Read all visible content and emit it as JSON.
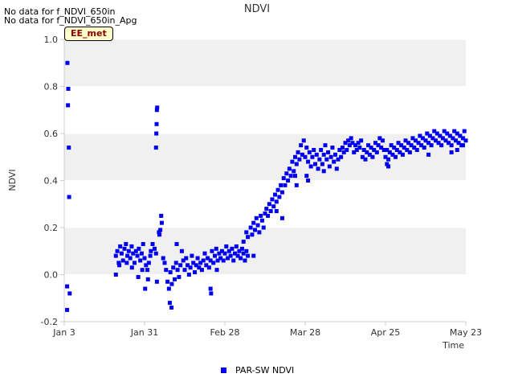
{
  "notes": [
    "No data for f_NDVI_650in",
    "No data for f_NDVI_650in_Apg"
  ],
  "badge": "EE_met",
  "colors": {
    "series": "#0000ee",
    "band": "#f0f0f0",
    "grid": "#ffffff",
    "axis": "#cccccc",
    "text": "#333333"
  },
  "chart_data": {
    "type": "scatter",
    "title": "NDVI",
    "xlabel": "Time",
    "ylabel": "NDVI",
    "ylim": [
      -0.2,
      1.0
    ],
    "yticks": [
      "-0.2",
      "0.0",
      "0.2",
      "0.4",
      "0.6",
      "0.8",
      "1.0"
    ],
    "xlim": [
      "Jan 3",
      "May 23"
    ],
    "xticks": [
      {
        "label": "Jan 3",
        "day": 0
      },
      {
        "label": "Jan 31",
        "day": 28
      },
      {
        "label": "Feb 28",
        "day": 56
      },
      {
        "label": "Mar 28",
        "day": 84
      },
      {
        "label": "Apr 25",
        "day": 112
      },
      {
        "label": "May 23",
        "day": 140
      }
    ],
    "grid": true,
    "legend": "bottom-center",
    "series": [
      {
        "name": "PAR-SW NDVI",
        "points": [
          [
            1.0,
            -0.05
          ],
          [
            1.1,
            0.9
          ],
          [
            1.3,
            0.72
          ],
          [
            1.4,
            0.79
          ],
          [
            1.6,
            0.54
          ],
          [
            1.7,
            0.33
          ],
          [
            1.9,
            -0.08
          ],
          [
            1.0,
            -0.15
          ],
          [
            18.0,
            0.08
          ],
          [
            18.5,
            0.1
          ],
          [
            19.0,
            0.05
          ],
          [
            19.5,
            0.12
          ],
          [
            20.0,
            0.09
          ],
          [
            20.5,
            0.06
          ],
          [
            21.0,
            0.11
          ],
          [
            21.5,
            0.13
          ],
          [
            22.0,
            0.08
          ],
          [
            22.5,
            0.1
          ],
          [
            23.0,
            0.07
          ],
          [
            23.5,
            0.12
          ],
          [
            24.0,
            0.09
          ],
          [
            24.5,
            0.05
          ],
          [
            25.0,
            0.1
          ],
          [
            25.5,
            0.08
          ],
          [
            26.0,
            0.11
          ],
          [
            26.5,
            0.06
          ],
          [
            27.0,
            0.09
          ],
          [
            27.5,
            0.13
          ],
          [
            28.0,
            0.07
          ],
          [
            28.5,
            0.04
          ],
          [
            29.0,
            0.02
          ],
          [
            29.5,
            0.05
          ],
          [
            30.0,
            0.08
          ],
          [
            18.0,
            0.0
          ],
          [
            19.2,
            0.04
          ],
          [
            21.8,
            0.05
          ],
          [
            23.6,
            0.03
          ],
          [
            25.8,
            -0.01
          ],
          [
            27.2,
            0.02
          ],
          [
            28.2,
            -0.06
          ],
          [
            30.2,
            0.1
          ],
          [
            30.8,
            0.13
          ],
          [
            31.5,
            0.11
          ],
          [
            32.0,
            0.09
          ],
          [
            29.2,
            -0.02
          ],
          [
            32.3,
            -0.03
          ],
          [
            33.2,
            0.17
          ],
          [
            33.5,
            0.19
          ],
          [
            33.8,
            0.25
          ],
          [
            34.0,
            0.22
          ],
          [
            32.0,
            0.54
          ],
          [
            32.1,
            0.6
          ],
          [
            32.2,
            0.64
          ],
          [
            32.3,
            0.7
          ],
          [
            32.4,
            0.71
          ],
          [
            33.0,
            0.18
          ],
          [
            34.5,
            0.07
          ],
          [
            35.0,
            0.05
          ],
          [
            35.5,
            0.02
          ],
          [
            36.0,
            -0.03
          ],
          [
            36.5,
            -0.06
          ],
          [
            37.0,
            0.01
          ],
          [
            37.5,
            -0.04
          ],
          [
            38.0,
            0.03
          ],
          [
            38.5,
            -0.02
          ],
          [
            39.0,
            0.05
          ],
          [
            39.5,
            0.02
          ],
          [
            40.0,
            -0.01
          ],
          [
            40.5,
            0.04
          ],
          [
            41.0,
            0.1
          ],
          [
            41.5,
            0.06
          ],
          [
            42.0,
            0.02
          ],
          [
            42.5,
            0.07
          ],
          [
            43.0,
            0.04
          ],
          [
            43.5,
            0.0
          ],
          [
            44.0,
            0.03
          ],
          [
            44.5,
            0.08
          ],
          [
            45.0,
            0.05
          ],
          [
            45.5,
            0.01
          ],
          [
            46.0,
            0.04
          ],
          [
            46.5,
            0.07
          ],
          [
            47.0,
            0.03
          ],
          [
            47.5,
            0.05
          ],
          [
            48.0,
            0.02
          ],
          [
            48.5,
            0.06
          ],
          [
            49.0,
            0.09
          ],
          [
            49.5,
            0.04
          ],
          [
            50.0,
            0.07
          ],
          [
            50.5,
            0.03
          ],
          [
            51.0,
            0.06
          ],
          [
            51.5,
            0.1
          ],
          [
            52.0,
            0.05
          ],
          [
            52.5,
            0.08
          ],
          [
            53.0,
            0.11
          ],
          [
            53.5,
            0.06
          ],
          [
            54.0,
            0.09
          ],
          [
            54.5,
            0.07
          ],
          [
            55.0,
            0.1
          ],
          [
            55.5,
            0.06
          ],
          [
            56.0,
            0.09
          ],
          [
            56.5,
            0.12
          ],
          [
            57.0,
            0.07
          ],
          [
            57.5,
            0.1
          ],
          [
            58.0,
            0.08
          ],
          [
            58.5,
            0.11
          ],
          [
            59.0,
            0.06
          ],
          [
            59.5,
            0.09
          ],
          [
            60.0,
            0.12
          ],
          [
            60.5,
            0.08
          ],
          [
            61.0,
            0.1
          ],
          [
            61.5,
            0.07
          ],
          [
            62.0,
            0.11
          ],
          [
            62.5,
            0.09
          ],
          [
            63.0,
            0.06
          ],
          [
            63.5,
            0.1
          ],
          [
            64.0,
            0.08
          ],
          [
            36.8,
            -0.12
          ],
          [
            37.4,
            -0.14
          ],
          [
            39.2,
            0.13
          ],
          [
            51.0,
            -0.06
          ],
          [
            51.2,
            -0.08
          ],
          [
            53.2,
            0.02
          ],
          [
            62.5,
            0.14
          ],
          [
            63.5,
            0.18
          ],
          [
            64.0,
            0.16
          ],
          [
            65.0,
            0.2
          ],
          [
            65.5,
            0.17
          ],
          [
            66.0,
            0.22
          ],
          [
            66.5,
            0.19
          ],
          [
            67.0,
            0.24
          ],
          [
            67.5,
            0.21
          ],
          [
            68.0,
            0.18
          ],
          [
            68.5,
            0.25
          ],
          [
            69.0,
            0.23
          ],
          [
            69.5,
            0.2
          ],
          [
            70.0,
            0.26
          ],
          [
            70.5,
            0.28
          ],
          [
            71.0,
            0.25
          ],
          [
            71.5,
            0.3
          ],
          [
            72.0,
            0.27
          ],
          [
            72.5,
            0.32
          ],
          [
            73.0,
            0.29
          ],
          [
            73.5,
            0.34
          ],
          [
            74.0,
            0.31
          ],
          [
            74.5,
            0.36
          ],
          [
            75.0,
            0.33
          ],
          [
            75.5,
            0.38
          ],
          [
            76.0,
            0.35
          ],
          [
            76.5,
            0.41
          ],
          [
            77.0,
            0.38
          ],
          [
            77.5,
            0.43
          ],
          [
            78.0,
            0.4
          ],
          [
            78.5,
            0.45
          ],
          [
            79.0,
            0.42
          ],
          [
            79.5,
            0.48
          ],
          [
            80.0,
            0.44
          ],
          [
            80.5,
            0.5
          ],
          [
            81.0,
            0.47
          ],
          [
            81.5,
            0.52
          ],
          [
            82.0,
            0.49
          ],
          [
            82.5,
            0.55
          ],
          [
            83.0,
            0.51
          ],
          [
            83.5,
            0.57
          ],
          [
            84.0,
            0.5
          ],
          [
            84.5,
            0.54
          ],
          [
            85.0,
            0.48
          ],
          [
            85.5,
            0.52
          ],
          [
            86.0,
            0.46
          ],
          [
            86.5,
            0.5
          ],
          [
            87.0,
            0.53
          ],
          [
            87.5,
            0.47
          ],
          [
            88.0,
            0.51
          ],
          [
            88.5,
            0.45
          ],
          [
            89.0,
            0.49
          ],
          [
            89.5,
            0.53
          ],
          [
            90.0,
            0.47
          ],
          [
            90.5,
            0.51
          ],
          [
            91.0,
            0.55
          ],
          [
            91.5,
            0.49
          ],
          [
            92.0,
            0.52
          ],
          [
            92.5,
            0.46
          ],
          [
            93.0,
            0.5
          ],
          [
            93.5,
            0.54
          ],
          [
            94.0,
            0.48
          ],
          [
            94.5,
            0.51
          ],
          [
            95.0,
            0.45
          ],
          [
            95.5,
            0.49
          ],
          [
            96.0,
            0.53
          ],
          [
            96.5,
            0.5
          ],
          [
            97.0,
            0.54
          ],
          [
            97.5,
            0.52
          ],
          [
            98.0,
            0.56
          ],
          [
            98.5,
            0.53
          ],
          [
            99.0,
            0.57
          ],
          [
            99.5,
            0.55
          ],
          [
            100.0,
            0.58
          ],
          [
            100.5,
            0.56
          ],
          [
            101.0,
            0.52
          ],
          [
            101.5,
            0.55
          ],
          [
            102.0,
            0.53
          ],
          [
            102.5,
            0.56
          ],
          [
            103.0,
            0.54
          ],
          [
            103.5,
            0.57
          ],
          [
            66.0,
            0.08
          ],
          [
            74.0,
            0.27
          ],
          [
            76.0,
            0.24
          ],
          [
            80.5,
            0.42
          ],
          [
            81.0,
            0.38
          ],
          [
            84.5,
            0.42
          ],
          [
            85.0,
            0.4
          ],
          [
            90.5,
            0.44
          ],
          [
            104.0,
            0.5
          ],
          [
            104.5,
            0.53
          ],
          [
            105.0,
            0.49
          ],
          [
            105.5,
            0.52
          ],
          [
            106.0,
            0.55
          ],
          [
            106.5,
            0.51
          ],
          [
            107.0,
            0.54
          ],
          [
            107.5,
            0.5
          ],
          [
            108.0,
            0.53
          ],
          [
            108.5,
            0.56
          ],
          [
            109.0,
            0.52
          ],
          [
            109.5,
            0.55
          ],
          [
            110.0,
            0.58
          ],
          [
            110.5,
            0.54
          ],
          [
            111.0,
            0.57
          ],
          [
            111.5,
            0.53
          ],
          [
            112.0,
            0.5
          ],
          [
            112.5,
            0.53
          ],
          [
            113.0,
            0.49
          ],
          [
            113.5,
            0.52
          ],
          [
            114.0,
            0.55
          ],
          [
            114.5,
            0.51
          ],
          [
            115.0,
            0.54
          ],
          [
            115.5,
            0.5
          ],
          [
            116.0,
            0.53
          ],
          [
            116.5,
            0.56
          ],
          [
            117.0,
            0.52
          ],
          [
            117.5,
            0.55
          ],
          [
            118.0,
            0.51
          ],
          [
            118.5,
            0.54
          ],
          [
            119.0,
            0.57
          ],
          [
            119.5,
            0.53
          ],
          [
            120.0,
            0.56
          ],
          [
            120.5,
            0.52
          ],
          [
            121.0,
            0.55
          ],
          [
            121.5,
            0.58
          ],
          [
            122.0,
            0.54
          ],
          [
            122.5,
            0.57
          ],
          [
            123.0,
            0.53
          ],
          [
            123.5,
            0.56
          ],
          [
            124.0,
            0.59
          ],
          [
            124.5,
            0.55
          ],
          [
            125.0,
            0.58
          ],
          [
            125.5,
            0.54
          ],
          [
            126.0,
            0.57
          ],
          [
            126.5,
            0.6
          ],
          [
            127.0,
            0.56
          ],
          [
            127.5,
            0.59
          ],
          [
            128.0,
            0.55
          ],
          [
            128.5,
            0.58
          ],
          [
            129.0,
            0.61
          ],
          [
            129.5,
            0.57
          ],
          [
            130.0,
            0.6
          ],
          [
            130.5,
            0.56
          ],
          [
            131.0,
            0.59
          ],
          [
            131.5,
            0.55
          ],
          [
            132.0,
            0.58
          ],
          [
            132.5,
            0.61
          ],
          [
            133.0,
            0.57
          ],
          [
            133.5,
            0.6
          ],
          [
            134.0,
            0.56
          ],
          [
            134.5,
            0.59
          ],
          [
            135.0,
            0.55
          ],
          [
            135.5,
            0.58
          ],
          [
            136.0,
            0.61
          ],
          [
            136.5,
            0.57
          ],
          [
            137.0,
            0.6
          ],
          [
            137.5,
            0.56
          ],
          [
            138.0,
            0.59
          ],
          [
            138.5,
            0.55
          ],
          [
            139.0,
            0.58
          ],
          [
            139.5,
            0.61
          ],
          [
            140.0,
            0.57
          ],
          [
            112.5,
            0.47
          ],
          [
            113.0,
            0.46
          ],
          [
            127.0,
            0.51
          ],
          [
            135.0,
            0.52
          ],
          [
            137.0,
            0.53
          ],
          [
            139.0,
            0.55
          ]
        ]
      }
    ]
  }
}
